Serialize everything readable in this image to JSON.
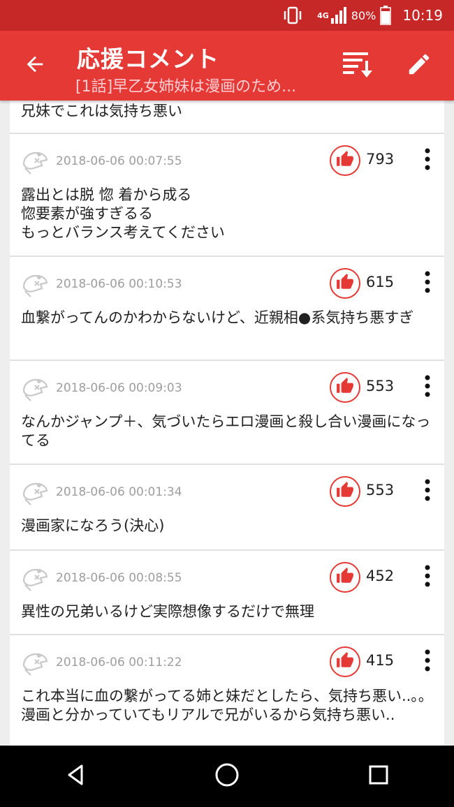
{
  "status_bar": {
    "network": "4G",
    "battery": "80%",
    "time": "10:19"
  },
  "app_bar": {
    "title": "応援コメント",
    "subtitle": "[1話]早乙女姉妹は漫画のため..."
  },
  "partial_comment": {
    "body": "兄妹でこれは気持ち悪い"
  },
  "comments": [
    {
      "date": "2018-06-06 00:07:55",
      "likes": "793",
      "body": "露出とは脱 惚 着から成る\n惚要素が強すぎるる\nもっとバランス考えてください"
    },
    {
      "date": "2018-06-06 00:10:53",
      "likes": "615",
      "body": "血繋がってんのかわからないけど、近親相●系気持ち悪すぎ"
    },
    {
      "date": "2018-06-06 00:09:03",
      "likes": "553",
      "body": "なんかジャンプ＋、気づいたらエロ漫画と殺し合い漫画になってる"
    },
    {
      "date": "2018-06-06 00:01:34",
      "likes": "553",
      "body": "漫画家になろう(決心)"
    },
    {
      "date": "2018-06-06 00:08:55",
      "likes": "452",
      "body": "異性の兄弟いるけど実際想像するだけで無理"
    },
    {
      "date": "2018-06-06 00:11:22",
      "likes": "415",
      "body": "これ本当に血の繋がってる姉と妹だとしたら、気持ち悪い..。。漫画と分かっていてもリアルで兄がいるから気持ち悪い.."
    }
  ],
  "icons": {
    "back": "arrow-left-icon",
    "sort": "sort-icon",
    "edit": "pencil-icon",
    "like": "thumbs-up-icon",
    "more": "more-vert-icon",
    "avatar": "pirate-avatar-icon",
    "nav_back": "triangle-back-icon",
    "nav_home": "circle-home-icon",
    "nav_recents": "square-recents-icon"
  },
  "colors": {
    "status_bar": "#c62828",
    "app_bar": "#e53935",
    "accent": "#e53935",
    "background": "#eeeeee",
    "card": "#ffffff"
  }
}
